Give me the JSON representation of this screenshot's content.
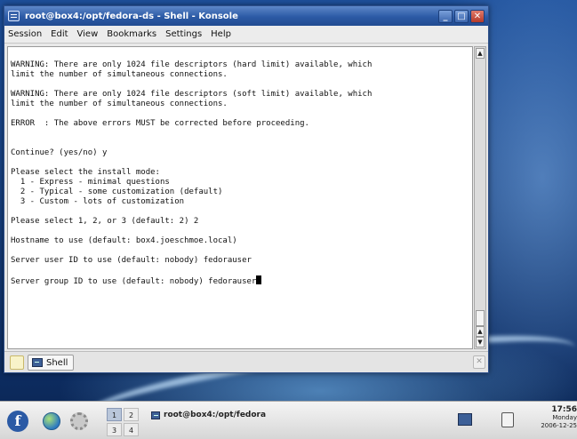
{
  "window": {
    "title": "root@box4:/opt/fedora-ds - Shell - Konsole",
    "buttons": {
      "minimize": "_",
      "maximize": "□",
      "close": "✕"
    }
  },
  "menu": [
    "Session",
    "Edit",
    "View",
    "Bookmarks",
    "Settings",
    "Help"
  ],
  "terminal": {
    "lines": [
      "",
      "WARNING: There are only 1024 file descriptors (hard limit) available, which",
      "limit the number of simultaneous connections.",
      "",
      "WARNING: There are only 1024 file descriptors (soft limit) available, which",
      "limit the number of simultaneous connections.",
      "",
      "ERROR  : The above errors MUST be corrected before proceeding.",
      "",
      "",
      "Continue? (yes/no) y",
      "",
      "Please select the install mode:",
      "  1 - Express - minimal questions",
      "  2 - Typical - some customization (default)",
      "  3 - Custom - lots of customization",
      "",
      "Please select 1, 2, or 3 (default: 2) 2",
      "",
      "Hostname to use (default: box4.joeschmoe.local)",
      "",
      "Server user ID to use (default: nobody) fedorauser",
      "",
      "Server group ID to use (default: nobody) fedorauser"
    ]
  },
  "tabbar": {
    "tab_label": "Shell"
  },
  "taskbar": {
    "pager": [
      "1",
      "2",
      "3",
      "4"
    ],
    "task_label": "root@box4:/opt/fedora",
    "clock_time": "17:56",
    "clock_day": "Monday",
    "clock_date": "2006-12-25"
  }
}
